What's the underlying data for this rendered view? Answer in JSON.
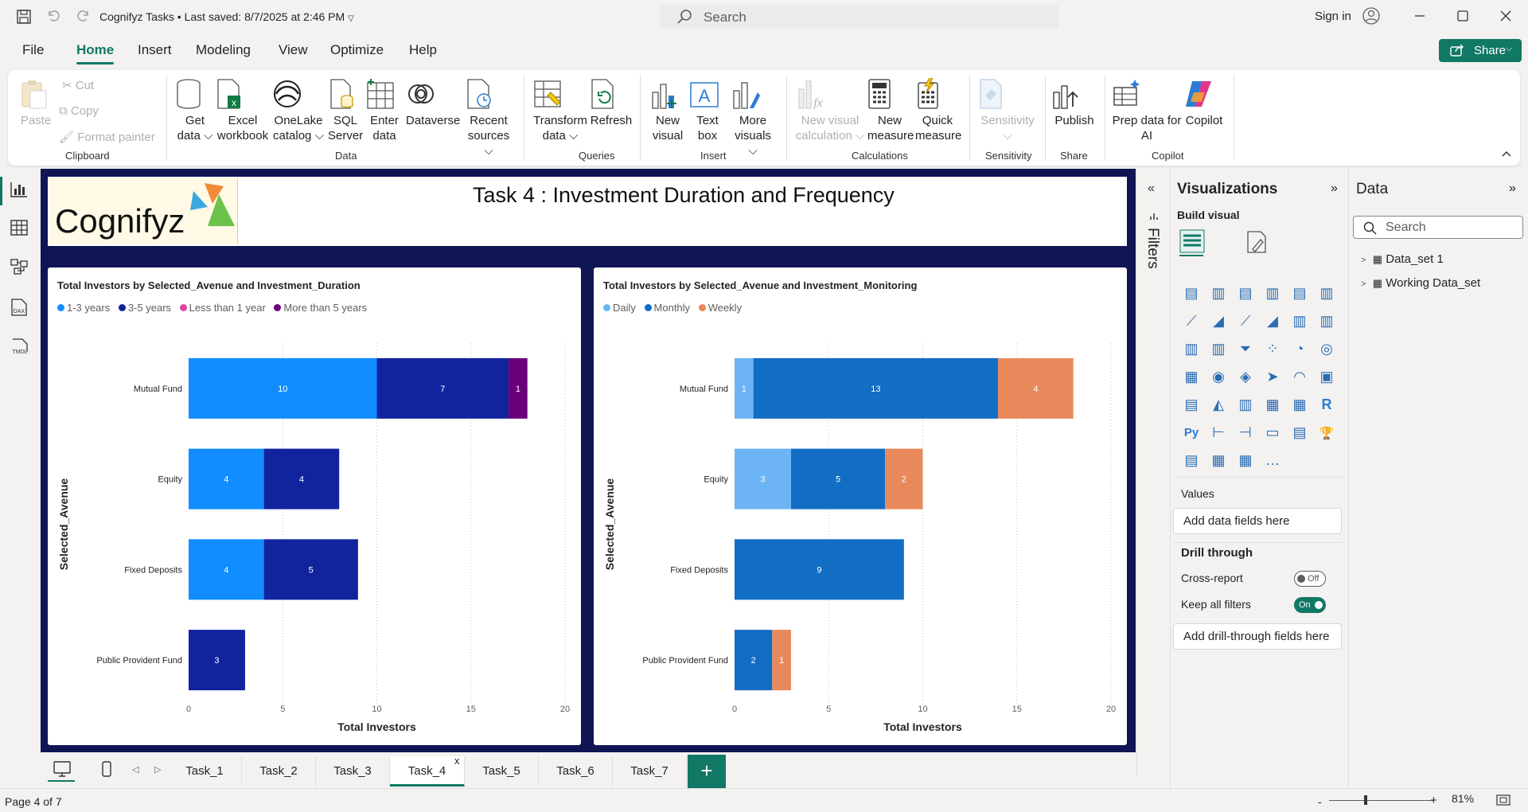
{
  "window": {
    "title": "Cognifyz Tasks",
    "last_saved": "Last saved: 8/7/2025 at 2:46 PM",
    "search_placeholder": "Search",
    "sign_in": "Sign in"
  },
  "menu": {
    "tabs": [
      "File",
      "Home",
      "Insert",
      "Modeling",
      "View",
      "Optimize",
      "Help"
    ],
    "active": "Home",
    "share_label": "Share"
  },
  "ribbon": {
    "clipboard": {
      "paste": "Paste",
      "cut": "Cut",
      "copy": "Copy",
      "format_painter": "Format painter",
      "group": "Clipboard"
    },
    "data": {
      "get_data": "Get data",
      "excel": "Excel workbook",
      "onelake": "OneLake catalog",
      "sql": "SQL Server",
      "enter_data": "Enter data",
      "dataverse": "Dataverse",
      "recent": "Recent sources",
      "group": "Data"
    },
    "queries": {
      "transform": "Transform data",
      "refresh": "Refresh",
      "group": "Queries"
    },
    "insert": {
      "new_visual": "New visual",
      "text_box": "Text box",
      "more_visuals": "More visuals",
      "group": "Insert"
    },
    "calculations": {
      "new_visual_calc": "New visual calculation",
      "new_measure": "New measure",
      "quick_measure": "Quick measure",
      "group": "Calculations"
    },
    "sensitivity": {
      "label": "Sensitivity",
      "group": "Sensitivity"
    },
    "share": {
      "publish": "Publish",
      "group": "Share"
    },
    "copilot": {
      "prep": "Prep data for AI",
      "copilot": "Copilot",
      "group": "Copilot"
    }
  },
  "report": {
    "logo_text": "Cognifyz",
    "title": "Task 4 :  Investment Duration and Frequency"
  },
  "chart_data": [
    {
      "type": "bar",
      "orientation": "horizontal",
      "stacked": true,
      "title": "Total Investors by Selected_Avenue and Investment_Duration",
      "categories": [
        "Mutual Fund",
        "Equity",
        "Fixed Deposits",
        "Public Provident Fund"
      ],
      "series": [
        {
          "name": "1-3 years",
          "color": "#118dff",
          "values": [
            10,
            4,
            4,
            0
          ]
        },
        {
          "name": "3-5 years",
          "color": "#12239e",
          "values": [
            7,
            4,
            5,
            3
          ]
        },
        {
          "name": "Less than 1 year",
          "color": "#e044a7",
          "values": [
            0,
            0,
            0,
            0
          ]
        },
        {
          "name": "More than 5 years",
          "color": "#6b007b",
          "values": [
            1,
            0,
            0,
            0
          ]
        }
      ],
      "xlabel": "Total Investors",
      "ylabel": "Selected_Avenue",
      "xlim": [
        0,
        20
      ],
      "xticks": [
        0,
        5,
        10,
        15,
        20
      ],
      "legend": "top-left",
      "grid": true
    },
    {
      "type": "bar",
      "orientation": "horizontal",
      "stacked": true,
      "title": "Total Investors by Selected_Avenue and Investment_Monitoring",
      "categories": [
        "Mutual Fund",
        "Equity",
        "Fixed Deposits",
        "Public Provident Fund"
      ],
      "series": [
        {
          "name": "Daily",
          "color": "#6cb4f5",
          "values": [
            1,
            3,
            0,
            0
          ]
        },
        {
          "name": "Monthly",
          "color": "#126dc5",
          "values": [
            13,
            5,
            9,
            2
          ]
        },
        {
          "name": "Weekly",
          "color": "#e8895c",
          "values": [
            4,
            2,
            0,
            1
          ]
        }
      ],
      "xlabel": "Total Investors",
      "ylabel": "Selected_Avenue",
      "xlim": [
        0,
        20
      ],
      "xticks": [
        0,
        5,
        10,
        15,
        20
      ],
      "legend": "top-left",
      "grid": true
    }
  ],
  "visualizations": {
    "title": "Visualizations",
    "build_visual": "Build visual",
    "values_label": "Values",
    "add_fields": "Add data fields here",
    "drill_through": "Drill through",
    "cross_report": "Cross-report",
    "cross_report_state": "Off",
    "keep_filters": "Keep all filters",
    "keep_filters_state": "On",
    "add_drill": "Add drill-through fields here"
  },
  "filters": {
    "label": "Filters"
  },
  "data_pane": {
    "title": "Data",
    "search_placeholder": "Search",
    "tables": [
      "Data_set 1",
      "Working Data_set"
    ]
  },
  "pages": {
    "tabs": [
      "Task_1",
      "Task_2",
      "Task_3",
      "Task_4",
      "Task_5",
      "Task_6",
      "Task_7"
    ],
    "active": "Task_4",
    "close_glyph": "x",
    "add_glyph": "+"
  },
  "status": {
    "page": "Page 4 of 7",
    "zoom": "81%"
  }
}
